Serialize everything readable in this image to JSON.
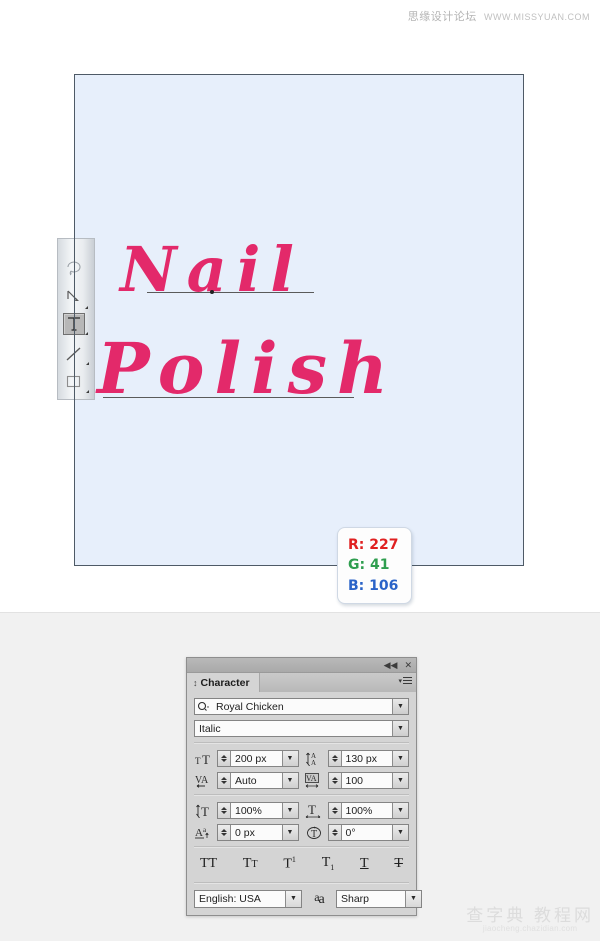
{
  "watermark_top": {
    "cn": "思缘设计论坛",
    "url": "WWW.MISSYUAN.COM"
  },
  "watermark_bottom": {
    "cn": "查字典 教程网",
    "url": "jiaocheng.chazidian.com"
  },
  "canvas": {
    "background_color": "#e7effb",
    "artwork_color": "#e3296a",
    "text_line_1": "Nail",
    "text_line_2": "Polish"
  },
  "color_callout": {
    "r_label": "R: 227",
    "g_label": "G: 41",
    "b_label": "B: 106",
    "r_color": "#e02020",
    "g_color": "#2f9e4f",
    "b_color": "#2a63c8"
  },
  "toolbar": {
    "tools": [
      {
        "name": "lasso-tool",
        "selected": false
      },
      {
        "name": "pen-tool",
        "selected": false
      },
      {
        "name": "type-tool",
        "selected": true
      },
      {
        "name": "line-tool",
        "selected": false
      },
      {
        "name": "rectangle-tool",
        "selected": false
      }
    ]
  },
  "character_panel": {
    "title": "Character",
    "collapse_icon": "◀◀",
    "close_icon": "✕",
    "font_family": "Royal Chicken",
    "font_style": "Italic",
    "font_size": "200 px",
    "leading": "130 px",
    "kerning": "Auto",
    "tracking": "100",
    "vertical_scale": "100%",
    "horizontal_scale": "100%",
    "baseline_shift": "0 px",
    "character_rotation": "0°",
    "style_buttons": [
      {
        "name": "all-caps",
        "label": "TT"
      },
      {
        "name": "small-caps",
        "label": "Tt"
      },
      {
        "name": "superscript",
        "label": "T1"
      },
      {
        "name": "subscript",
        "label": "T1"
      },
      {
        "name": "underline",
        "label": "T"
      },
      {
        "name": "strikethrough",
        "label": "T"
      }
    ],
    "language": "English: USA",
    "anti_aliasing": "Sharp",
    "dropdown_arrow": "▼"
  }
}
